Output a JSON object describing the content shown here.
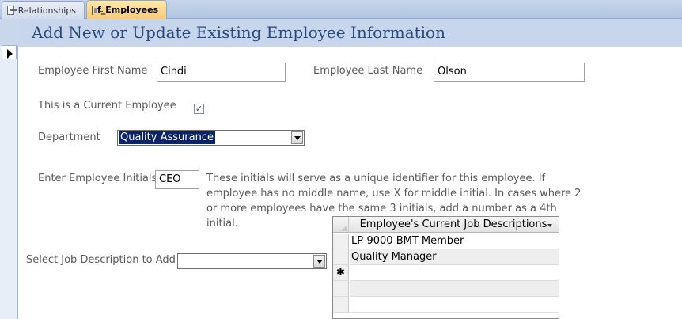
{
  "tabs": [
    {
      "label": "Relationships",
      "icon": "relationships-icon"
    },
    {
      "label": "f_Employees",
      "icon": "form-icon"
    }
  ],
  "form": {
    "title": "Add New or Update Existing Employee Information",
    "first_name_label": "Employee First Name",
    "first_name_value": "Cindi",
    "last_name_label": "Employee Last Name",
    "last_name_value": "Olson",
    "current_label": "This is a Current Employee",
    "current_checked": true,
    "department_label": "Department",
    "department_value": "Quality Assurance",
    "initials_label": "Enter Employee Initials",
    "initials_value": "CEO",
    "initials_help": "These initials will serve as a unique identifier for this employee.  If employee has no middle name, use X for middle initial.  In cases where 2 or more employees have the same 3 initials, add a number as a 4th initial.",
    "job_add_label": "Select Job Description to Add",
    "job_add_value": ""
  },
  "subform": {
    "column_header": "Employee's Current Job Descriptions",
    "rows": [
      "LP-9000 BMT Member",
      "Quality Manager"
    ],
    "new_row_marker": "✱"
  },
  "colors": {
    "header_bg": "#c7d6ec",
    "title": "#2a4a7f",
    "active_tab": "#f8c978",
    "combo_selection": "#0a246a"
  }
}
